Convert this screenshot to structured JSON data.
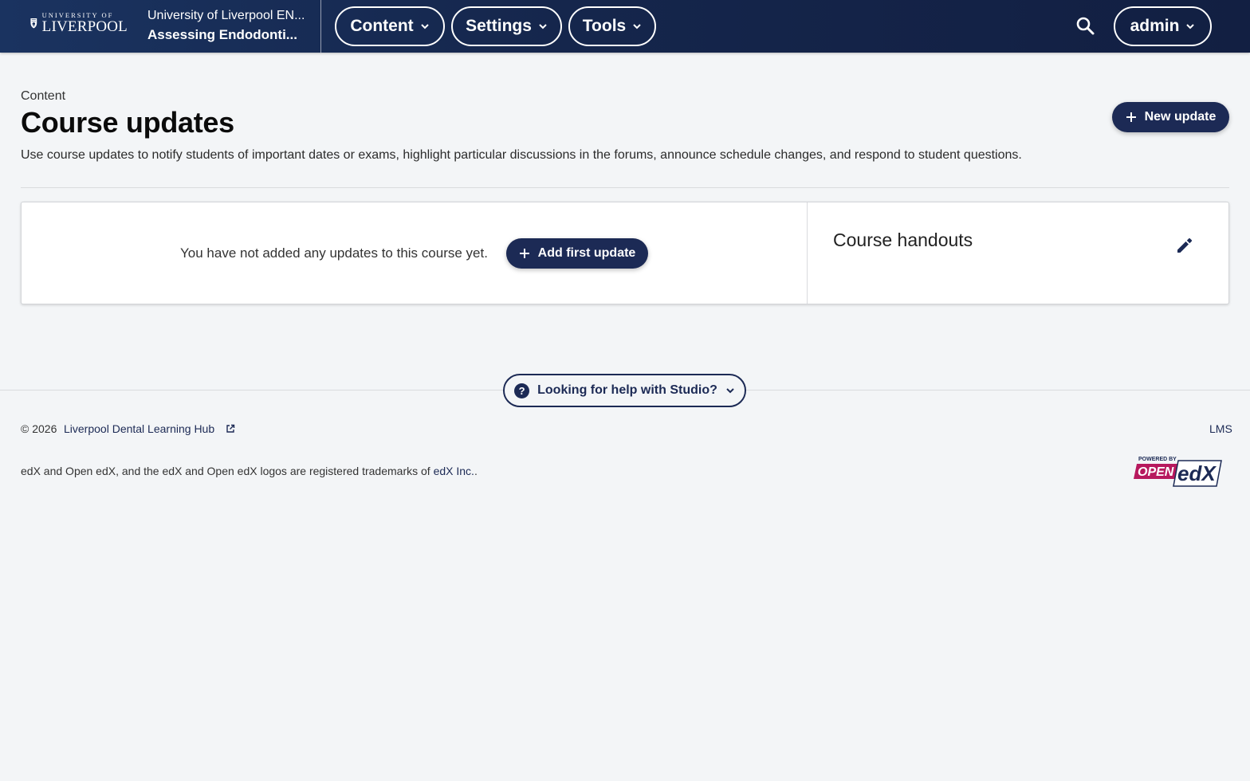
{
  "header": {
    "logo": {
      "line1": "UNIVERSITY OF",
      "line2": "LIVERPOOL",
      "icon": "university-crest-icon"
    },
    "course_org": "University of Liverpool EN...",
    "course_name": "Assessing Endodonti...",
    "nav": [
      {
        "label": "Content"
      },
      {
        "label": "Settings"
      },
      {
        "label": "Tools"
      }
    ],
    "user_menu": {
      "label": "admin"
    },
    "search_icon": "search-icon"
  },
  "main": {
    "breadcrumb": "Content",
    "title": "Course updates",
    "description": "Use course updates to notify students of important dates or exams, highlight particular discussions in the forums, announce schedule changes, and respond to student questions.",
    "new_update_label": "New update",
    "empty_message": "You have not added any updates to this course yet.",
    "add_first_update_label": "Add first update",
    "handouts_title": "Course handouts"
  },
  "help": {
    "label": "Looking for help with Studio?"
  },
  "footer": {
    "copyright": "© 2026",
    "hub_link": "Liverpool Dental Learning Hub",
    "lms_link": "LMS",
    "trademark_text": "edX and Open edX, and the edX and Open edX logos are registered trademarks of",
    "trademark_link": "edX Inc.",
    "trademark_end": ".",
    "powered_by": "POWERED BY",
    "open_text": "OPEN",
    "edx_text": "edX"
  },
  "colors": {
    "header_bg": "#15264c",
    "brand_button": "#1c2a55",
    "page_bg": "#f3f5f7",
    "openedx_magenta": "#b7195e"
  }
}
